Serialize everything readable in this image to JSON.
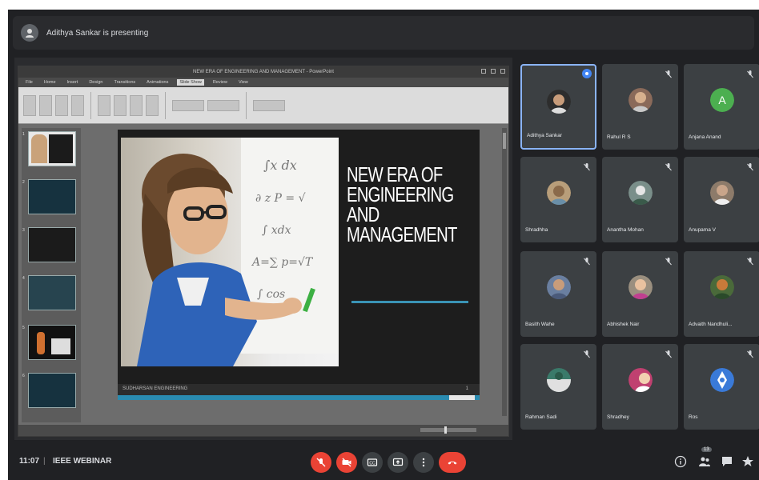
{
  "topbar": {
    "presenter_text": "Adithya Sankar is presenting"
  },
  "powerpoint": {
    "window_title": "NEW ERA OF ENGINEERING AND MANAGEMENT - PowerPoint",
    "tabs": [
      "File",
      "Home",
      "Insert",
      "Design",
      "Transitions",
      "Animations",
      "Slide Show",
      "Review",
      "View"
    ],
    "active_tab_index": 6,
    "thumbnail_numbers": [
      "1",
      "2",
      "3",
      "4",
      "5",
      "6"
    ]
  },
  "slide": {
    "title": "NEW ERA OF ENGINEERING AND MANAGEMENT",
    "footer_left": "SUDHARSAN ENGINEERING",
    "footer_right": "1"
  },
  "participants": [
    {
      "name": "Adithya Sankar",
      "active": true,
      "avatar_color": "#2d2d2d"
    },
    {
      "name": "Rahul R S",
      "active": false,
      "avatar_color": "#8a6a5a"
    },
    {
      "name": "Anjana Anand",
      "active": false,
      "avatar_color": "#4caf50",
      "initial": "A"
    },
    {
      "name": "Shradhha",
      "active": false,
      "avatar_color": "#b89e7a"
    },
    {
      "name": "Anantha Mohan",
      "active": false,
      "avatar_color": "#7a8f8a"
    },
    {
      "name": "Anupama V",
      "active": false,
      "avatar_color": "#8d7b6a"
    },
    {
      "name": "Basith Wahe",
      "active": false,
      "avatar_color": "#6a7fa0"
    },
    {
      "name": "Abhishek Nair",
      "active": false,
      "avatar_color": "#9a8f7f"
    },
    {
      "name": "Advaith Nandhuli...",
      "active": false,
      "avatar_color": "#4a6a3a"
    },
    {
      "name": "Rahman Sadi",
      "active": false,
      "avatar_color": "#3a7a6a"
    },
    {
      "name": "Shradhey",
      "active": false,
      "avatar_color": "#c04070"
    },
    {
      "name": "Ros",
      "active": false,
      "avatar_color": "#3a7ad8"
    }
  ],
  "bottombar": {
    "time": "11:07",
    "separator": "|",
    "meeting_name": "IEEE WEBINAR",
    "participants_badge": "13"
  },
  "colors": {
    "end_call": "#ea4335",
    "active_border": "#8ab4f8",
    "slide_accent": "#3a93b5"
  }
}
